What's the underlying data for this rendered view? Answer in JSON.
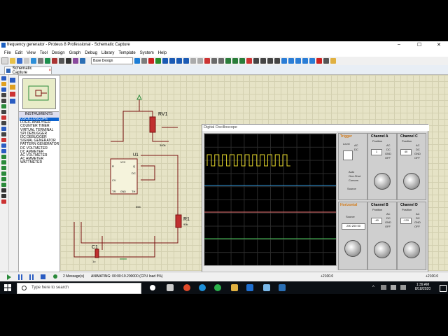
{
  "window": {
    "title": "frequency generator - Proteus 8 Professional - Schematic Capture",
    "controls": [
      "–",
      "☐",
      "✕"
    ]
  },
  "menu": [
    "File",
    "Edit",
    "View",
    "Tool",
    "Design",
    "Graph",
    "Debug",
    "Library",
    "Template",
    "System",
    "Help"
  ],
  "toolbar": {
    "design_select": "Base Design"
  },
  "tab": {
    "label": "Schematic Capture"
  },
  "instruments": {
    "header": "INSTRUMENTS",
    "items": [
      "OSCILLOSCOPE",
      "LOGIC ANALYSER",
      "COUNTER TIMER",
      "VIRTUAL TERMINAL",
      "SPI DEBUGGER",
      "I2C DEBUGGER",
      "SIGNAL GENERATOR",
      "PATTERN GENERATOR",
      "DC VOLTMETER",
      "DC AMMETER",
      "AC VOLTMETER",
      "AC AMMETER",
      "WATTMETER"
    ],
    "selected": "OSCILLOSCOPE"
  },
  "schematic": {
    "rv1": "RV1",
    "rv1_value": "300k",
    "u1": "U1",
    "u1_part": "555",
    "r1": "R1",
    "r1_value": "90k",
    "c1": "C1",
    "c1_value": "1u",
    "pins": [
      "R",
      "Q",
      "DC",
      "CV",
      "TR",
      "TH",
      "VCC",
      "GND"
    ]
  },
  "oscilloscope": {
    "title": "Digital Oscilloscope",
    "trigger": {
      "label": "Trigger",
      "level": "Level",
      "modes": [
        "Auto",
        "One-Shot",
        "Cursors"
      ],
      "source": "Source"
    },
    "horizontal": {
      "label": "Horizontal",
      "source": "Source",
      "time_value": "200 200 50"
    },
    "channels": [
      {
        "name": "Channel A",
        "color": "#e7d92b",
        "value": "1"
      },
      {
        "name": "Channel C",
        "color": "#e86f6f",
        "value": "40"
      },
      {
        "name": "Channel B",
        "color": "#36a0e6",
        "value": "-40"
      },
      {
        "name": "Channel D",
        "color": "#49c95a",
        "value": "-120"
      }
    ],
    "couplings": [
      "AC",
      "DC",
      "GND",
      "OFF",
      "Invert"
    ],
    "position": "Position"
  },
  "status": {
    "messages": "2 Message(s)",
    "animating": "ANIMATING: 00:00:19.200000 (CPU load 5%)",
    "coord_x": "+2100.0",
    "coord_y": "+2100.0"
  },
  "taskbar": {
    "search_placeholder": "Type here to search",
    "time": "1:39 AM",
    "date": "8/18/2020"
  },
  "colors": {
    "trace_a": "#e7d92b",
    "trace_b": "#36a0e6",
    "trace_c": "#e86f6f",
    "trace_d": "#49c95a",
    "wire": "#7a1010"
  }
}
